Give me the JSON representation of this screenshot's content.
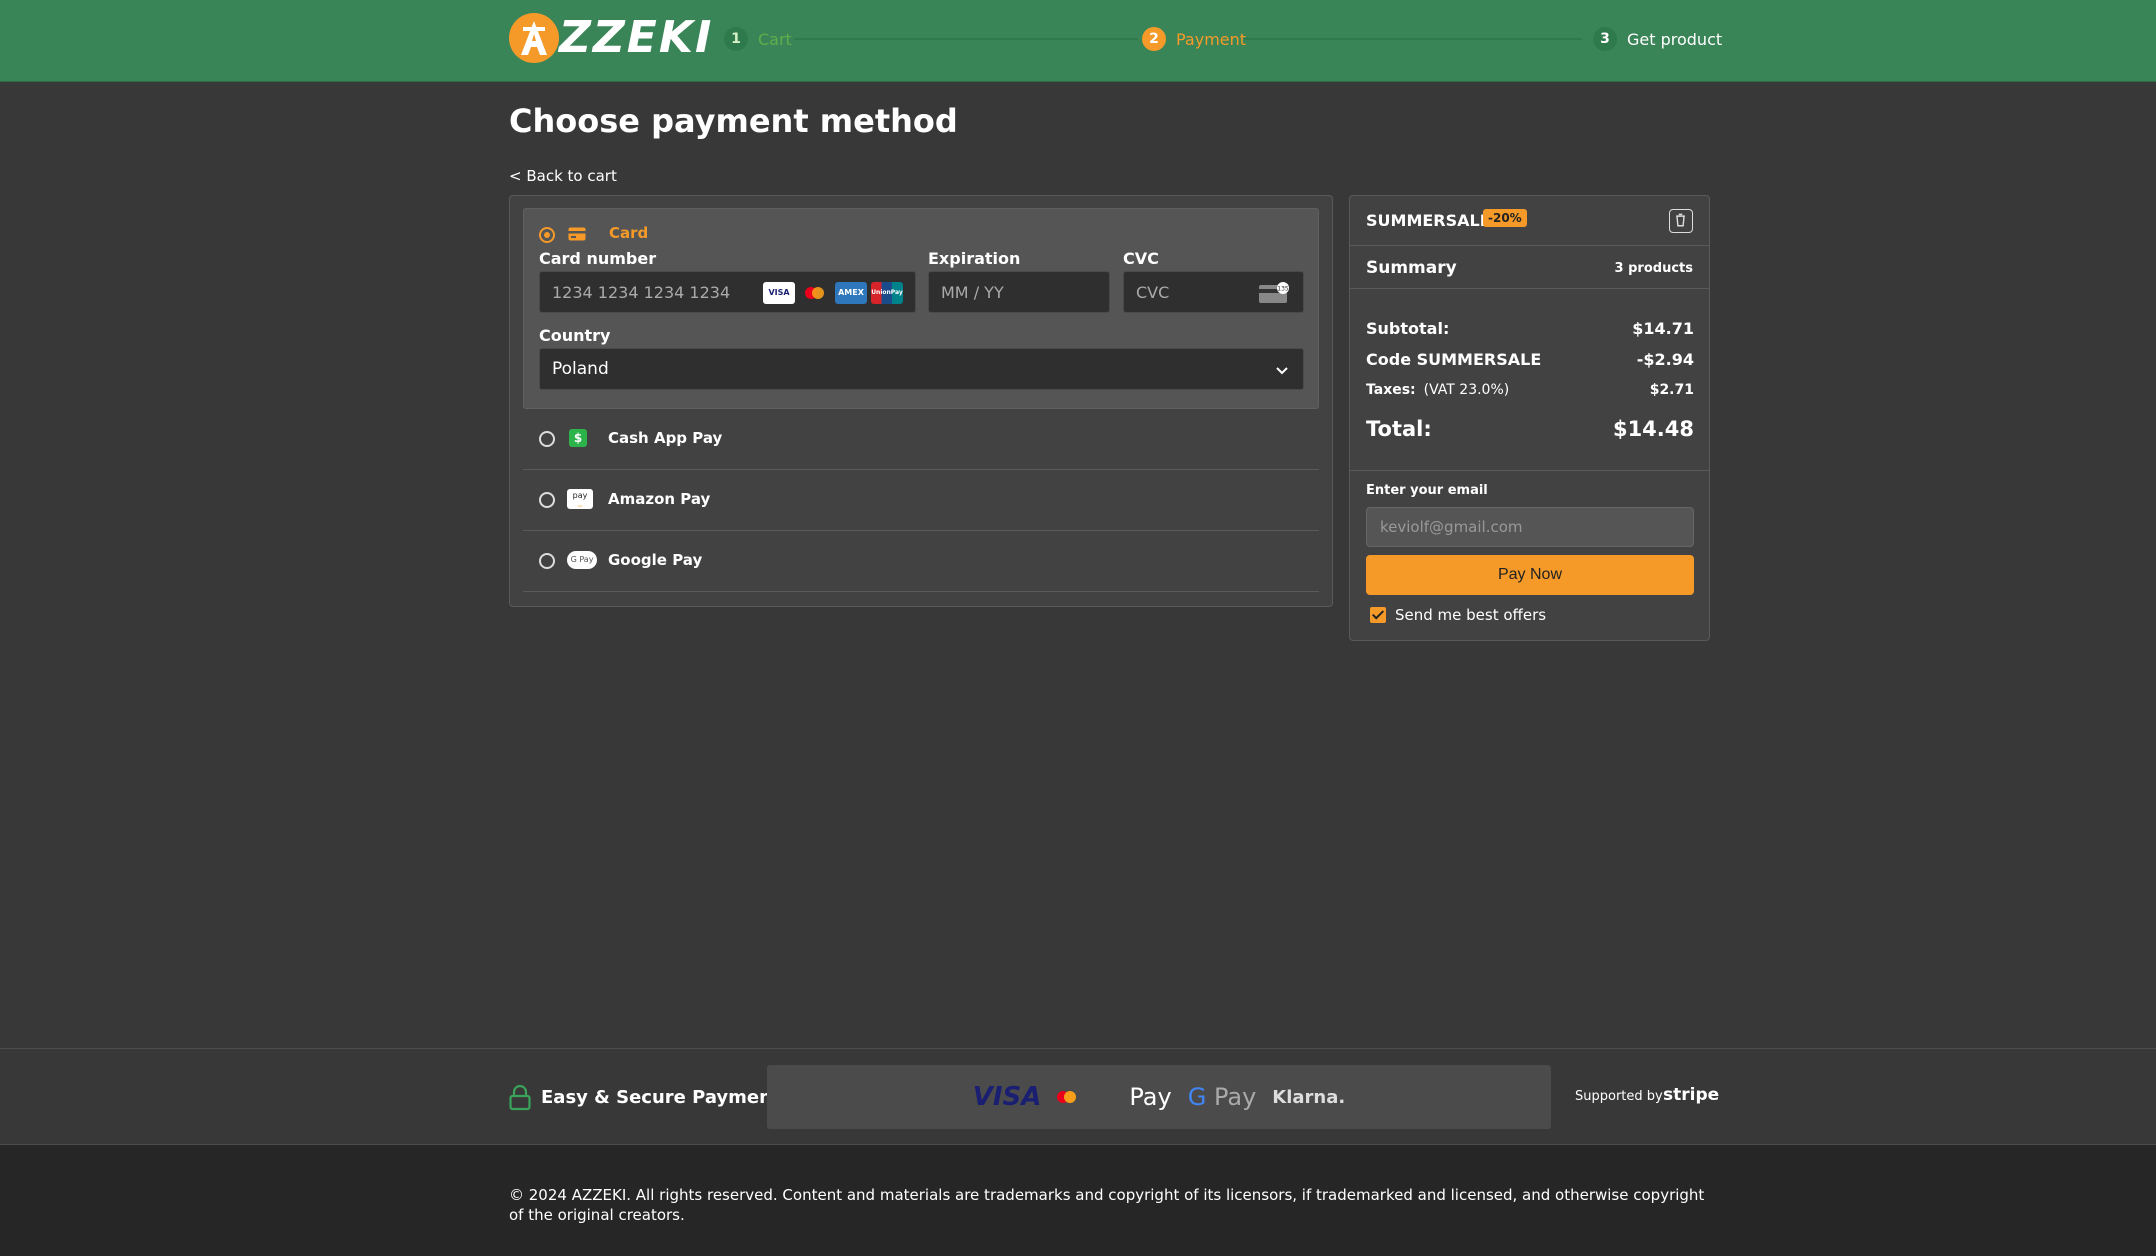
{
  "header": {
    "logo_text": "ZZEKI",
    "steps": [
      {
        "num": "1",
        "label": "Cart"
      },
      {
        "num": "2",
        "label": "Payment"
      },
      {
        "num": "3",
        "label": "Get product"
      }
    ],
    "colors": {
      "brand": "#3a8558",
      "accent": "#f59a29"
    }
  },
  "page": {
    "title": "Choose payment method",
    "back_link": "< Back to cart"
  },
  "payment": {
    "card": {
      "label": "Card",
      "number_label": "Card number",
      "number_placeholder": "1234 1234 1234 1234",
      "expiration_label": "Expiration",
      "expiration_placeholder": "MM / YY",
      "cvc_label": "CVC",
      "cvc_placeholder": "CVC",
      "country_label": "Country",
      "country_value": "Poland",
      "card_brand_badges": [
        "VISA",
        "",
        "AMEX",
        "UnionPay"
      ]
    },
    "methods": [
      {
        "label": "Cash App Pay",
        "icon": "cash-app-icon"
      },
      {
        "label": "Amazon Pay",
        "icon": "amazon-pay-icon"
      },
      {
        "label": "Google Pay",
        "icon": "google-pay-icon"
      }
    ]
  },
  "summary": {
    "promo_code": "SUMMERSALE",
    "promo_badge": "-20%",
    "title": "Summary",
    "count": "3 products",
    "subtotal_label": "Subtotal:",
    "subtotal_value": "$14.71",
    "code_label": "Code SUMMERSALE",
    "code_value": "-$2.94",
    "taxes_label": "Taxes:",
    "taxes_note": "(VAT 23.0%)",
    "taxes_value": "$2.71",
    "total_label": "Total:",
    "total_value": "$14.48",
    "email_label": "Enter your email",
    "email_placeholder": "keviolf@gmail.com",
    "pay_button": "Pay Now",
    "offers_label": "Send me best offers"
  },
  "trust": {
    "secure_text": "Easy & Secure Payments",
    "brands": {
      "visa": "VISA",
      "apple_pay": "Pay",
      "google_pay": "Pay",
      "klarna": "Klarna."
    },
    "supported_by": "Supported by",
    "stripe": "stripe"
  },
  "footer": {
    "copyright": "© 2024 AZZEKI. All rights reserved. Content and materials are trademarks and copyright of its licensors, if trademarked and licensed, and otherwise copyright of the original creators."
  }
}
